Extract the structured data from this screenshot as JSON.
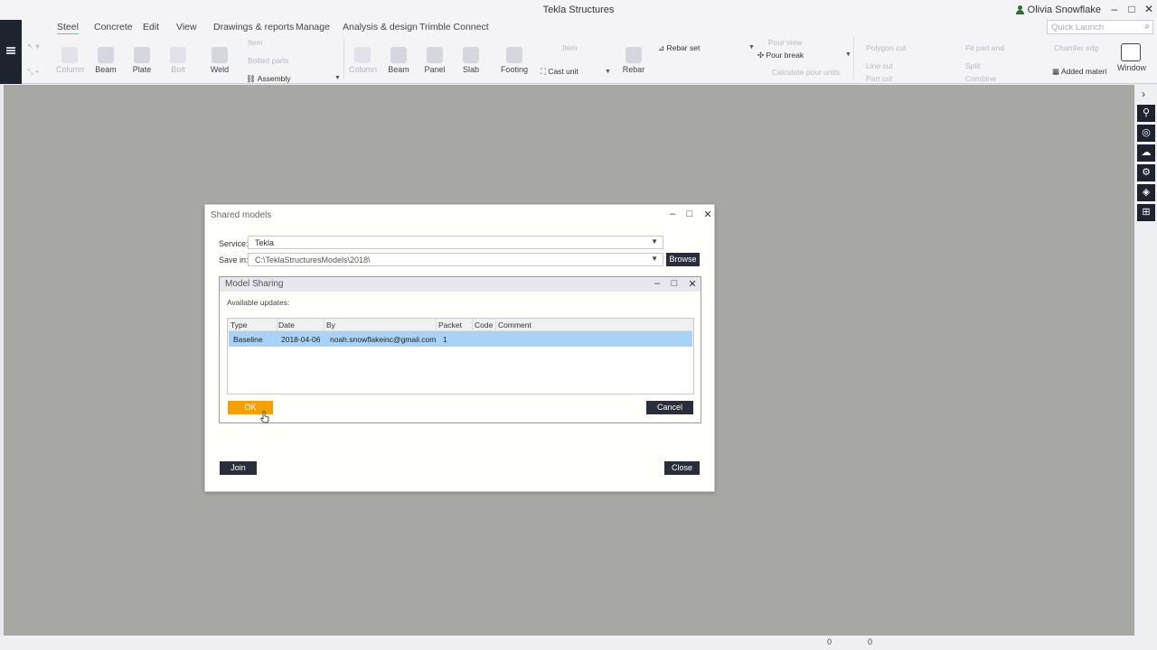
{
  "window": {
    "title": "Tekla Structures",
    "user": "Olivia Snowflake"
  },
  "ribbon_tabs": [
    "Steel",
    "Concrete",
    "Edit",
    "View",
    "Drawings & reports",
    "Manage",
    "Analysis & design",
    "Trimble Connect"
  ],
  "quick_launch_placeholder": "Quick Launch",
  "ribbon": {
    "steel_big": [
      "Column",
      "Beam",
      "Plate",
      "Bolt",
      "Weld"
    ],
    "steel_small": [
      "Item",
      "Bolted parts",
      "Assembly"
    ],
    "concrete_big": [
      "Column",
      "Beam",
      "Panel",
      "Slab",
      "Footing"
    ],
    "cast_unit": "Cast unit",
    "item": "Item",
    "rebar_set": "Rebar set",
    "rebar": "Rebar",
    "pour": [
      "Pour view",
      "Pour break",
      "Calculate pour units"
    ],
    "cuts": [
      "Polygon cut",
      "Line cut",
      "Part cut"
    ],
    "fit": [
      "Fit part end",
      "Split",
      "Combine"
    ],
    "chamfer": "Chamfer edg",
    "added_material": "Added materi",
    "window": "Window"
  },
  "status": {
    "value1": "0",
    "value2": "0"
  },
  "shared_models": {
    "title": "Shared models",
    "service_label": "Service:",
    "service_value": "Tekla",
    "save_in_label": "Save in:",
    "save_in_value": "C:\\TeklaStructuresModels\\2018\\",
    "browse": "Browse",
    "join": "Join",
    "close": "Close"
  },
  "model_sharing": {
    "title": "Model Sharing",
    "available_updates": "Available updates:",
    "columns": [
      "Type",
      "Date",
      "By",
      "Packet",
      "Code",
      "Comment"
    ],
    "rows": [
      {
        "type": "Baseline",
        "date": "2018-04-06",
        "by": "noah.snowflakeinc@gmail.com",
        "packet": "1",
        "code": "",
        "comment": ""
      }
    ],
    "ok": "OK",
    "cancel": "Cancel"
  }
}
